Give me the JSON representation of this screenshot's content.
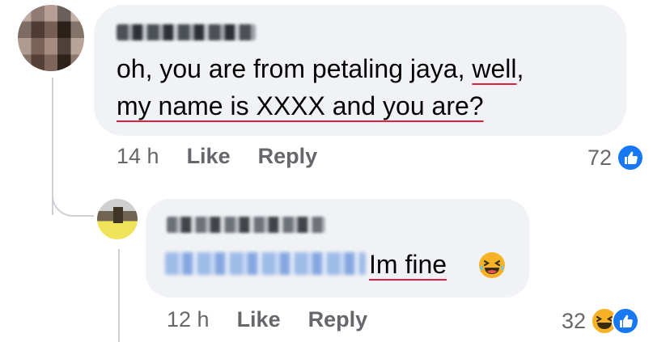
{
  "comment": {
    "author_redacted": true,
    "text_line1_pre": "oh, you are from petaling jaya, ",
    "text_line1_ul": "well",
    "text_line1_post": ",",
    "text_line2_ul": "my name is XXXX and you are?",
    "time": "14 h",
    "like_label": "Like",
    "reply_label": "Reply",
    "reaction_count": "72",
    "reactions": [
      "like-icon"
    ]
  },
  "reply": {
    "author_redacted": true,
    "mention_redacted": true,
    "text_ul": "Im fine",
    "emoji": "laughing-emoji",
    "time": "12 h",
    "like_label": "Like",
    "reply_label": "Reply",
    "reaction_count": "32",
    "reactions": [
      "haha-icon",
      "like-icon"
    ]
  },
  "colors": {
    "bubble_bg": "#f0f2f5",
    "meta_text": "#65676b",
    "underline_red": "#e41e3f",
    "like_blue": "#1877f2",
    "haha_yellow": "#f7b125"
  }
}
